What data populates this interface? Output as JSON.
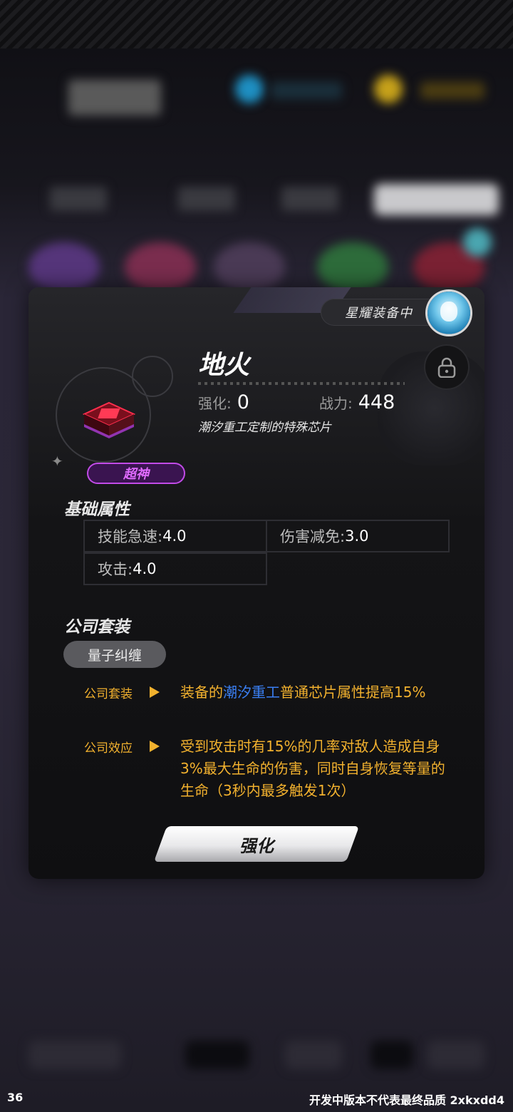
{
  "item": {
    "name": "地火",
    "enhance_label": "强化:",
    "enhance_value": "0",
    "power_label": "战力:",
    "power_value": "448",
    "description": "潮汐重工定制的特殊芯片",
    "rarity": "超神",
    "equipped_status": "星耀装备中"
  },
  "base_attributes": {
    "title": "基础属性",
    "items": [
      {
        "label": "技能急速:",
        "value": "4.0"
      },
      {
        "label": "伤害减免:",
        "value": "3.0"
      },
      {
        "label": "攻击:",
        "value": "4.0"
      }
    ]
  },
  "company_set": {
    "title": "公司套装",
    "tag": "量子纠缠",
    "effects": [
      {
        "label": "公司套装",
        "text_before": "装备的",
        "highlight": "潮汐重工",
        "text_after": "普通芯片属性提高15%"
      },
      {
        "label": "公司效应",
        "text": "受到攻击时有15%的几率对敌人造成自身3%最大生命的伤害，同时自身恢复等量的生命（3秒内最多触发1次）"
      }
    ]
  },
  "actions": {
    "enhance_button": "强化"
  },
  "footer": {
    "left": "36",
    "right": "开发中版本不代表最终品质 2xkxdd4"
  },
  "colors": {
    "accent_orange": "#f2b12e",
    "highlight_blue": "#3a7ff2",
    "rarity_purple": "#c24be8"
  }
}
